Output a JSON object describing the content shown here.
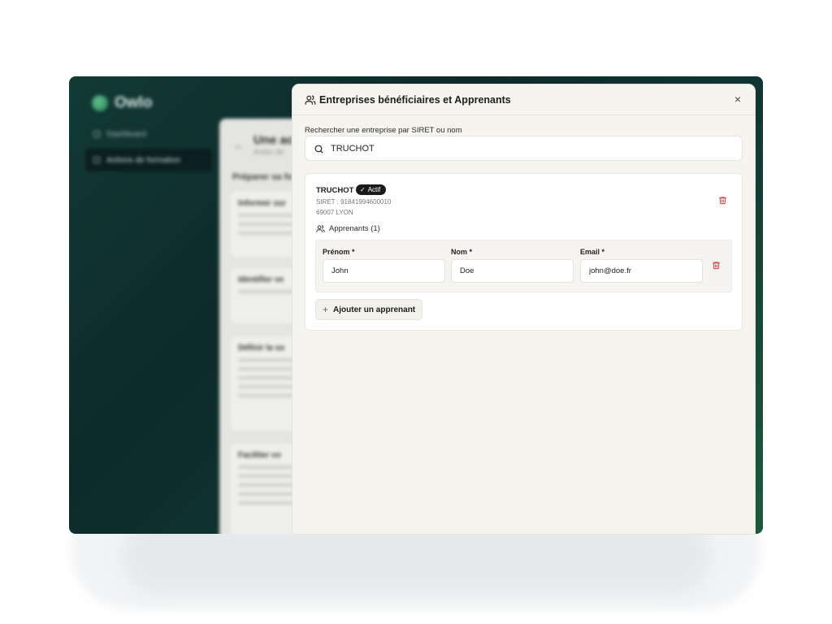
{
  "background_app": {
    "logo_text": "Owlo",
    "sidebar": [
      {
        "label": "Dashboard",
        "active": false
      },
      {
        "label": "Actions de formation",
        "active": true
      }
    ],
    "panel_title": "Une ac",
    "panel_subtitle": "Action de",
    "panel_section": "Préparer sa fo",
    "cards": [
      {
        "title": "Informer sur"
      },
      {
        "title": "Identifier ve"
      },
      {
        "title": "Définir la so"
      },
      {
        "title": "Faciliter vo"
      }
    ]
  },
  "modal": {
    "title": "Entreprises bénéficiaires et Apprenants",
    "title_icon": "users-icon",
    "close_icon": "×",
    "search": {
      "label": "Rechercher une entreprise par SIRET ou nom",
      "value": "TRUCHOT",
      "icon": "search-icon"
    },
    "company": {
      "name": "TRUCHOT",
      "status": "Actif",
      "status_icon": "✓",
      "siret": "SIRET : 91841994600010",
      "city": "69007 LYON",
      "learners_title": "Apprenants (1)",
      "learners": [
        {
          "prenom": "John",
          "nom": "Doe",
          "email": "john@doe.fr"
        }
      ],
      "fields": {
        "prenom_label": "Prénom *",
        "nom_label": "Nom *",
        "email_label": "Email *"
      },
      "add_button": "Ajouter un apprenant",
      "add_icon": "+"
    }
  },
  "colors": {
    "accent_dark": "#1a1a1a",
    "danger": "#e03131",
    "modal_bg": "#f5f4ef",
    "frame_bg": "#0f3532"
  }
}
